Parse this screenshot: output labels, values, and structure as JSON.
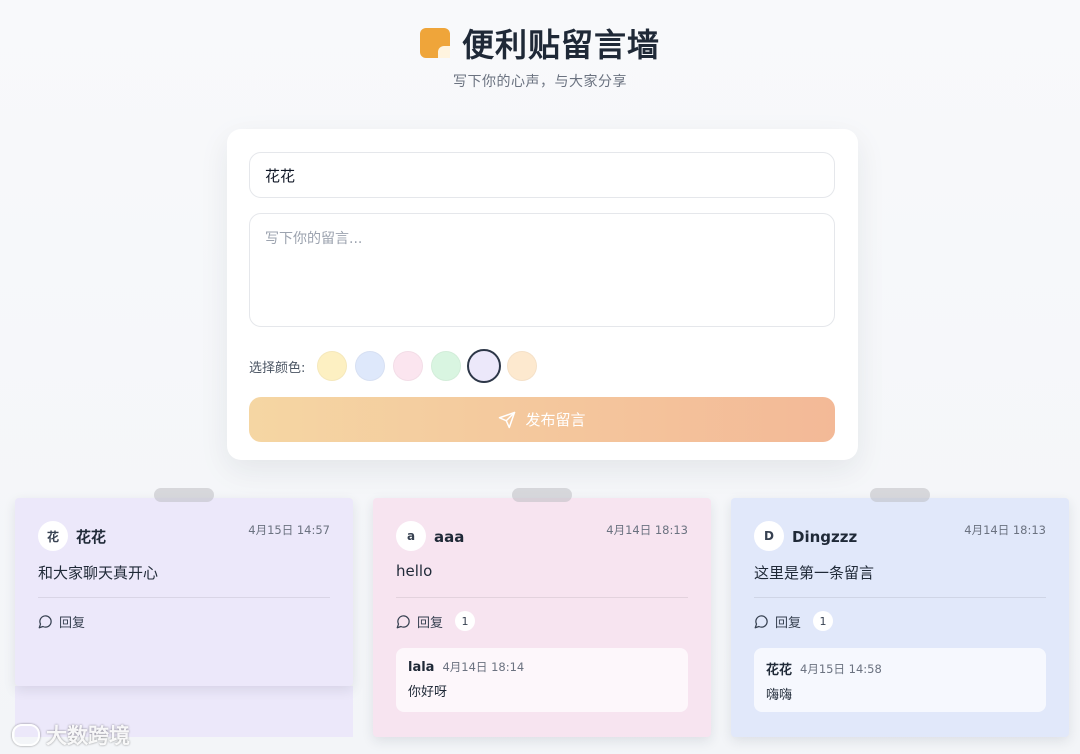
{
  "header": {
    "title": "便利贴留言墙",
    "subtitle": "写下你的心声，与大家分享"
  },
  "composer": {
    "name_value": "花花",
    "message_placeholder": "写下你的留言...",
    "color_label": "选择颜色:",
    "colors": [
      "#fdf0c2",
      "#dee8fb",
      "#fbe5ef",
      "#d9f5e1",
      "#ece8fa",
      "#fde9cf"
    ],
    "selected_color_index": 4,
    "submit_label": "发布留言",
    "submit_gradient": [
      "#f5d6a3",
      "#f3b997"
    ]
  },
  "notes": [
    {
      "avatar": "花",
      "author": "花花",
      "time": "4月15日 14:57",
      "content": "和大家聊天真开心",
      "reply_label": "回复",
      "reply_count": "",
      "color": "#ece8fa",
      "replies": []
    },
    {
      "avatar": "a",
      "author": "aaa",
      "time": "4月14日 18:13",
      "content": "hello",
      "reply_label": "回复",
      "reply_count": "1",
      "color": "#f7e4f0",
      "replies": [
        {
          "author": "lala",
          "time": "4月14日 18:14",
          "text": "你好呀"
        }
      ]
    },
    {
      "avatar": "D",
      "author": "Dingzzz",
      "time": "4月14日 18:13",
      "content": "这里是第一条留言",
      "reply_label": "回复",
      "reply_count": "1",
      "color": "#e1e8fa",
      "replies": [
        {
          "author": "花花",
          "time": "4月15日 14:58",
          "text": "嗨嗨"
        }
      ]
    }
  ],
  "watermark": {
    "text": "大数跨境"
  }
}
